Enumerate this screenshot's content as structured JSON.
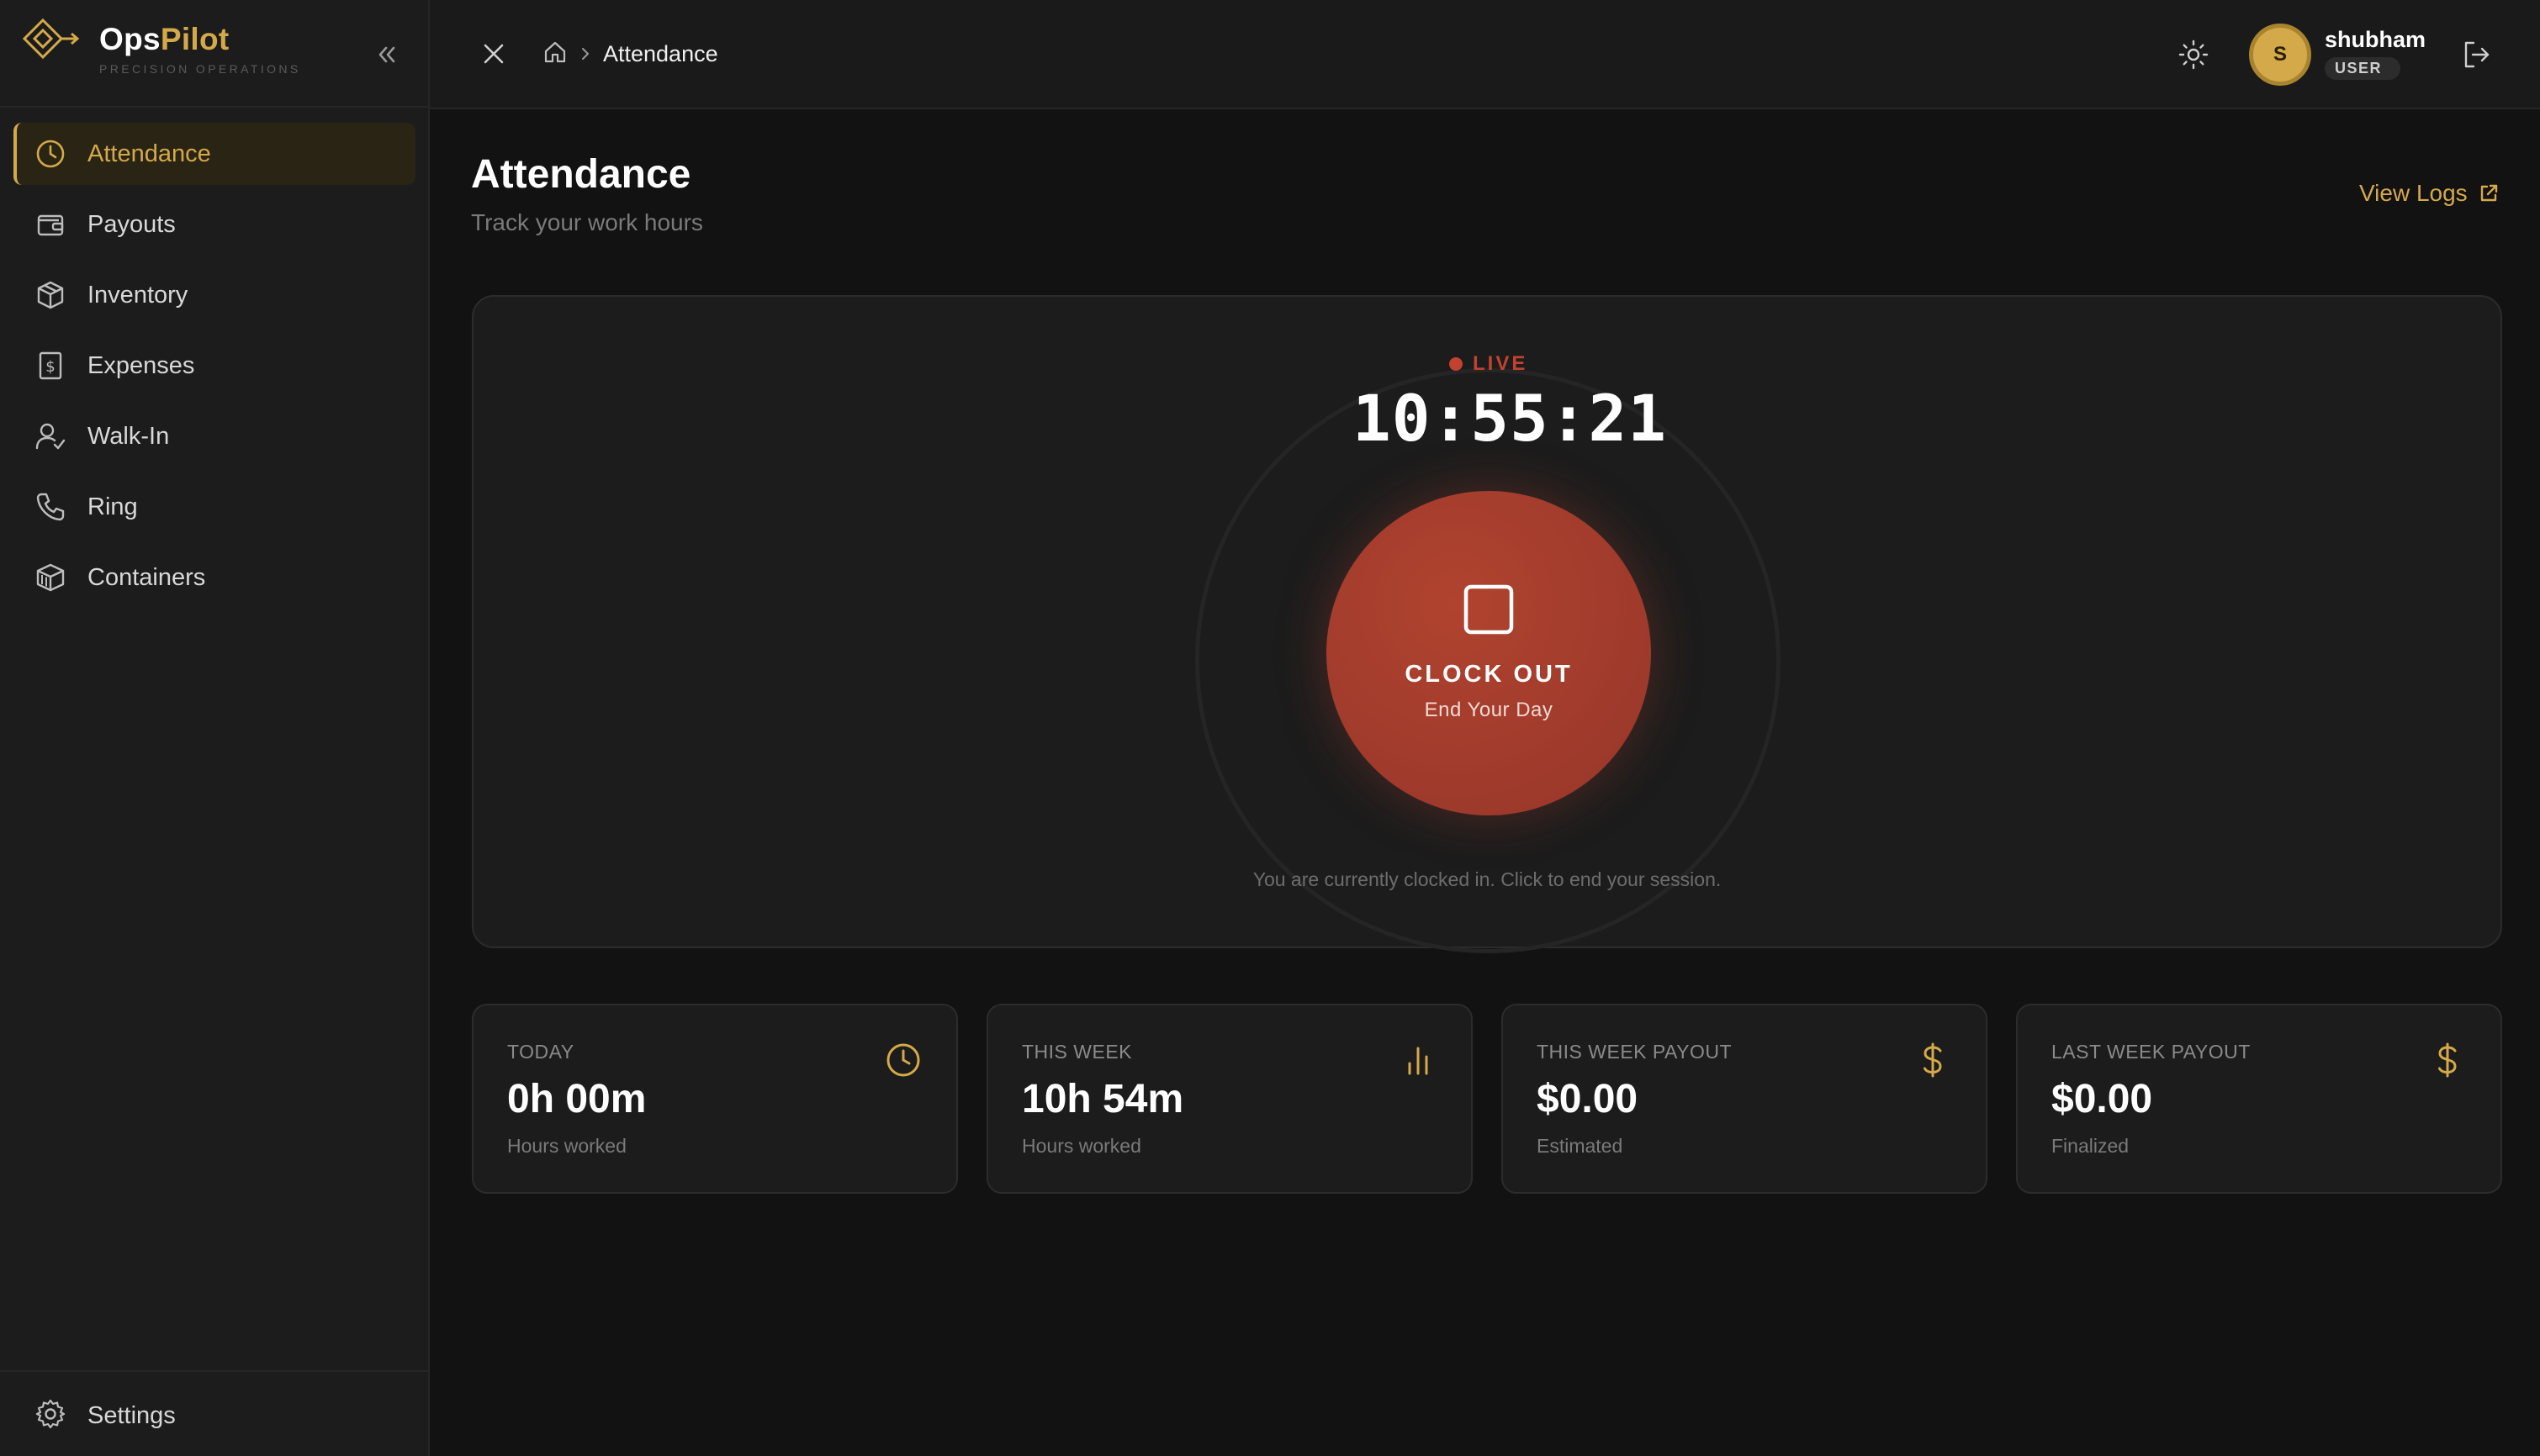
{
  "brand": {
    "name_part1": "Ops",
    "name_part2": "Pilot",
    "tagline": "PRECISION OPERATIONS"
  },
  "sidebar": {
    "items": [
      {
        "label": "Attendance",
        "icon": "clock-icon",
        "active": true
      },
      {
        "label": "Payouts",
        "icon": "wallet-icon"
      },
      {
        "label": "Inventory",
        "icon": "box-icon"
      },
      {
        "label": "Expenses",
        "icon": "receipt-dollar-icon"
      },
      {
        "label": "Walk-In",
        "icon": "user-check-icon"
      },
      {
        "label": "Ring",
        "icon": "phone-icon"
      },
      {
        "label": "Containers",
        "icon": "container-icon"
      }
    ],
    "footer": {
      "label": "Settings",
      "icon": "gear-icon"
    }
  },
  "topbar": {
    "breadcrumb": {
      "current": "Attendance"
    },
    "user": {
      "initial": "S",
      "name": "shubham",
      "role": "USER"
    }
  },
  "page": {
    "title": "Attendance",
    "subtitle": "Track your work hours",
    "view_logs": "View Logs"
  },
  "timer": {
    "status": "LIVE",
    "time": "10:55:21",
    "button_title": "CLOCK OUT",
    "button_sub": "End Your Day",
    "hint": "You are currently clocked in. Click to end your session."
  },
  "stats": [
    {
      "label": "TODAY",
      "value": "0h 00m",
      "sub": "Hours worked",
      "icon": "clock-icon"
    },
    {
      "label": "THIS WEEK",
      "value": "10h 54m",
      "sub": "Hours worked",
      "icon": "bar-chart-icon"
    },
    {
      "label": "THIS WEEK PAYOUT",
      "value": "$0.00",
      "sub": "Estimated",
      "icon": "dollar-icon"
    },
    {
      "label": "LAST WEEK PAYOUT",
      "value": "$0.00",
      "sub": "Finalized",
      "icon": "dollar-icon"
    }
  ],
  "colors": {
    "accent": "#d4a94a",
    "danger": "#b0432f",
    "background": "#121212",
    "surface": "#1c1c1c"
  }
}
